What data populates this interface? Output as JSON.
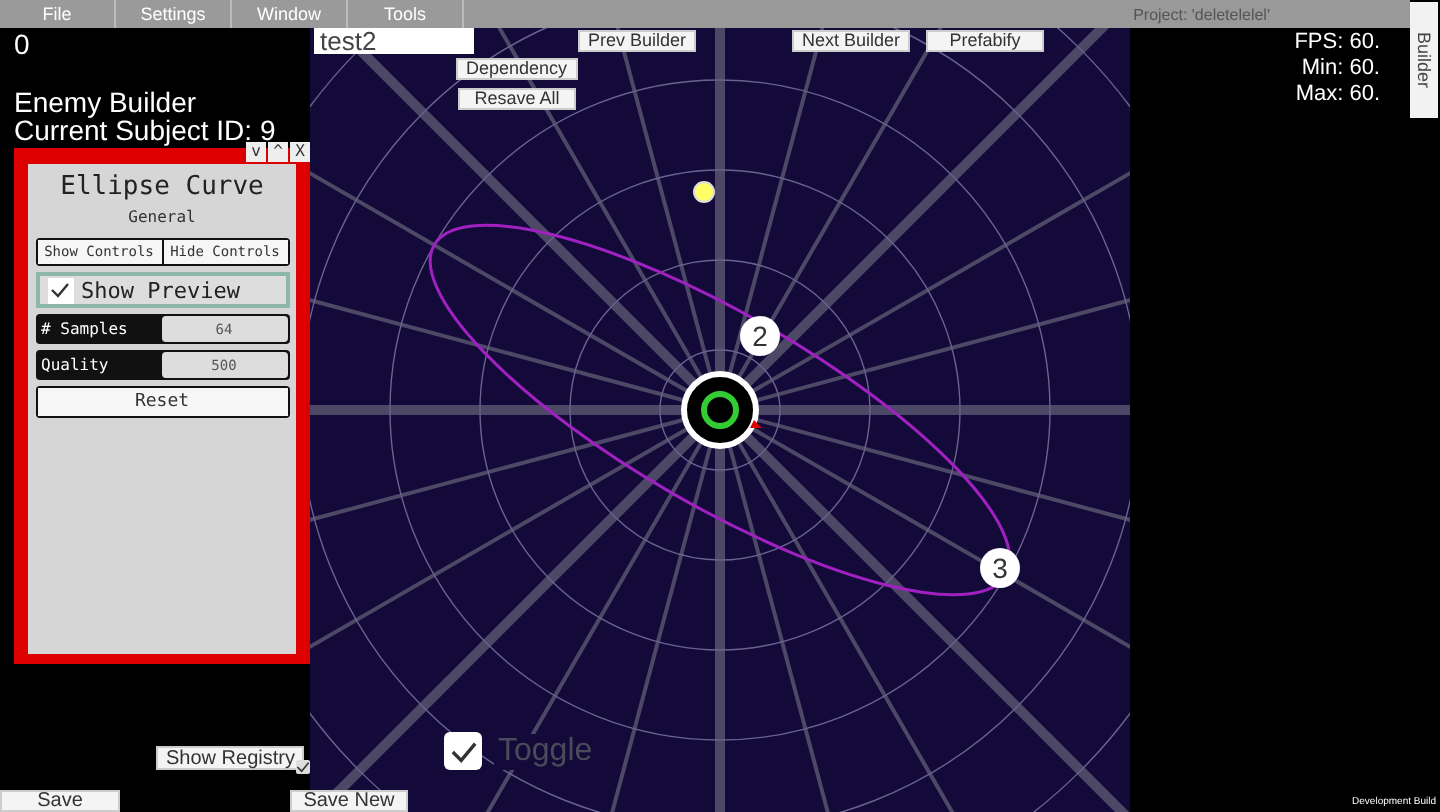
{
  "menu": [
    "File",
    "Settings",
    "Window",
    "Tools"
  ],
  "project": "Project: 'deletelelel'",
  "counter": "0",
  "builder_title": "Enemy Builder",
  "subject": "Current Subject ID: 9",
  "name_field": {
    "value": "test2"
  },
  "toolbar": {
    "prev": "Prev Builder",
    "next": "Next Builder",
    "prefab": "Prefabify",
    "dependency": "Dependency",
    "resave": "Resave All"
  },
  "stats": [
    "FPS: 60.",
    "Min: 60.",
    "Max: 60."
  ],
  "side_tab": "Builder",
  "panel": {
    "window_controls": [
      "v",
      "^",
      "X"
    ],
    "title": "Ellipse Curve",
    "section": "General",
    "buttons": [
      "Show Controls",
      "Hide Controls"
    ],
    "preview": {
      "label": "Show Preview",
      "checked": true
    },
    "fields": [
      {
        "label": "# Samples",
        "value": "64"
      },
      {
        "label": "Quality",
        "value": "500"
      }
    ],
    "reset": "Reset"
  },
  "scene": {
    "points": [
      {
        "label": "2"
      },
      {
        "label": "3"
      }
    ]
  },
  "show_registry": "Show Registry",
  "small_toggle": {
    "checked": true
  },
  "big_toggle": {
    "label": "Toggle",
    "checked": true
  },
  "save": "Save",
  "save_new": "Save New",
  "build_note": "Development Build"
}
